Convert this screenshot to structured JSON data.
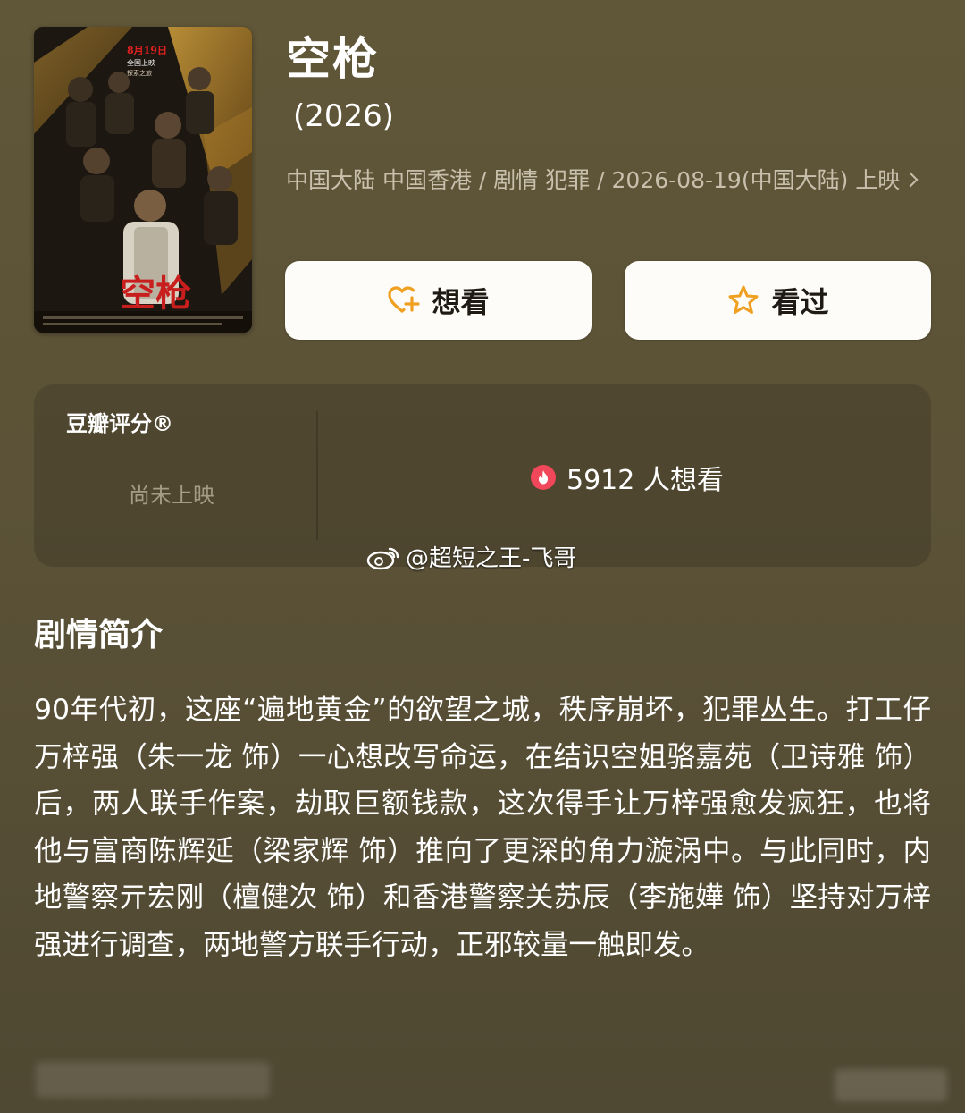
{
  "movie": {
    "title": "空枪",
    "year": "(2026)",
    "meta_line": "中国大陆 中国香港 / 剧情 犯罪 / 2026-08-19(中国大陆) 上映",
    "poster": {
      "release_badge_line1": "8月19日",
      "release_badge_line2": "全国上映",
      "release_badge_line3": "探索之旅",
      "calligraphy_title": "空枪"
    }
  },
  "actions": {
    "want_label": "想看",
    "seen_label": "看过",
    "want_icon": "heart-plus-icon",
    "seen_icon": "star-icon"
  },
  "rating": {
    "brand": "豆瓣评分®",
    "status": "尚未上映",
    "wish_count_text": "5912 人想看",
    "wish_icon": "flame-icon"
  },
  "watermark": {
    "text": "@超短之王-飞哥",
    "icon": "weibo-icon"
  },
  "synopsis": {
    "heading": "剧情简介",
    "body": "90年代初，这座“遍地黄金”的欲望之城，秩序崩坏，犯罪丛生。打工仔万梓强（朱一龙 饰）一心想改写命运，在结识空姐骆嘉苑（卫诗雅 饰）后，两人联手作案，劫取巨额钱款，这次得手让万梓强愈发疯狂，也将他与富商陈辉延（梁家辉 饰）推向了更深的角力漩涡中。与此同时，内地警察亓宏刚（檀健次 饰）和香港警察关苏辰（李施嬅 饰）坚持对万梓强进行调查，两地警方联手行动，正邪较量一触即发。"
  },
  "colors": {
    "background": "#5d5338",
    "button_bg": "#fdfcf9",
    "accent_orange": "#f0a020",
    "flame_red": "#f0475a"
  }
}
